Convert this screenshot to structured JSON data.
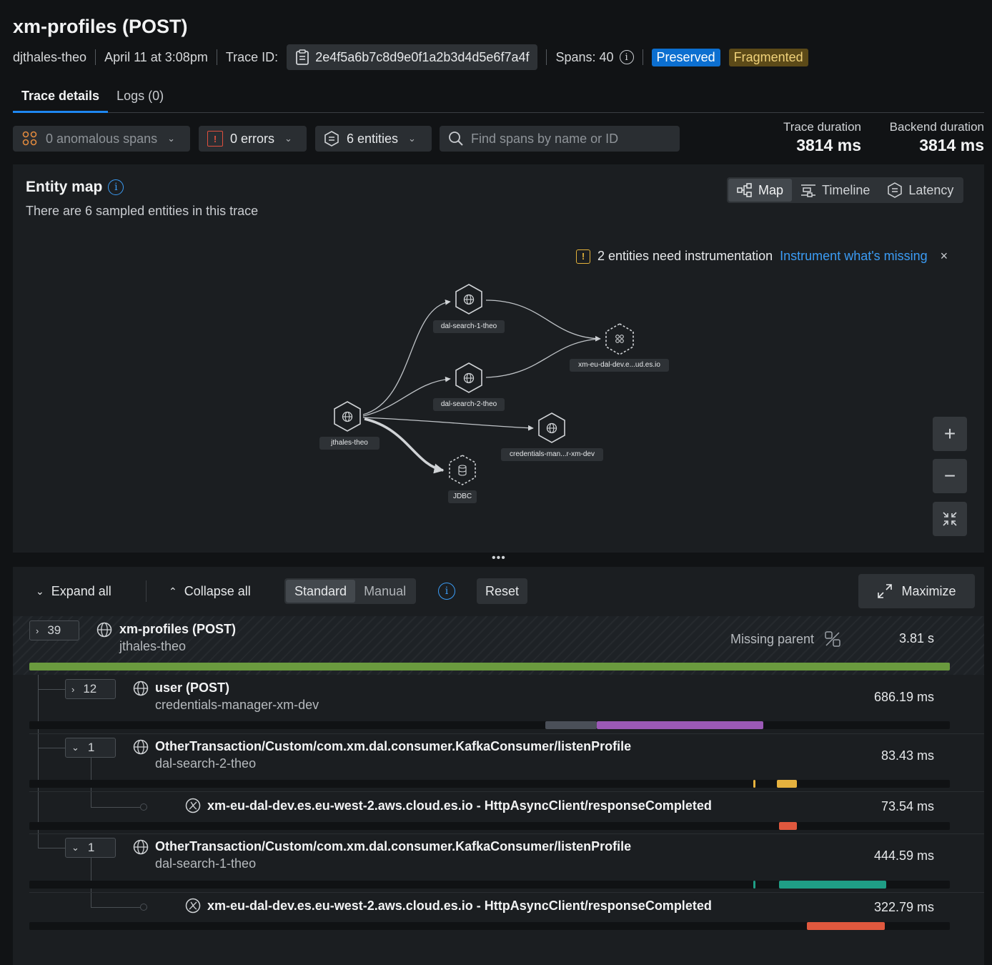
{
  "header": {
    "title": "xm-profiles (POST)",
    "user": "djthales-theo",
    "timestamp": "April 11 at 3:08pm",
    "trace_id_label": "Trace ID:",
    "trace_id": "2e4f5a6b7c8d9e0f1a2b3d4d5e6f7a4f",
    "spans_label": "Spans: 40",
    "badge_preserved": "Preserved",
    "badge_fragmented": "Fragmented"
  },
  "tabs": [
    {
      "label": "Trace details",
      "active": true
    },
    {
      "label": "Logs (0)",
      "active": false
    }
  ],
  "filters": {
    "anomalous": "0 anomalous spans",
    "errors": "0 errors",
    "entities": "6 entities",
    "search_placeholder": "Find spans by name or ID"
  },
  "durations": {
    "trace_label": "Trace duration",
    "trace_value": "3814 ms",
    "backend_label": "Backend duration",
    "backend_value": "3814 ms"
  },
  "entity_map": {
    "title": "Entity map",
    "subtitle": "There are 6 sampled entities in this trace",
    "view_map": "Map",
    "view_timeline": "Timeline",
    "view_latency": "Latency",
    "warning_text": "2 entities need instrumentation",
    "warning_link": "Instrument what's missing",
    "close": "×",
    "nodes": {
      "root": "jthales-theo",
      "search1": "dal-search-1-theo",
      "search2": "dal-search-2-theo",
      "es": "xm-eu-dal-dev.e...ud.es.io",
      "cred": "credentials-man...r-xm-dev",
      "jdbc": "JDBC"
    },
    "zoom_in": "+",
    "zoom_out": "−"
  },
  "toolbar": {
    "expand_all": "Expand all",
    "collapse_all": "Collapse all",
    "mode_standard": "Standard",
    "mode_manual": "Manual",
    "reset": "Reset",
    "maximize": "Maximize"
  },
  "spans": {
    "root": {
      "count": "39",
      "name": "xm-profiles (POST)",
      "entity": "jthales-theo",
      "status": "Missing parent",
      "duration": "3.81 s"
    },
    "s1": {
      "count": "12",
      "name": "user (POST)",
      "entity": "credentials-manager-xm-dev",
      "duration": "686.19 ms"
    },
    "s2": {
      "count": "1",
      "name": "OtherTransaction/Custom/com.xm.dal.consumer.KafkaConsumer/listenProfile",
      "entity": "dal-search-2-theo",
      "duration": "83.43 ms"
    },
    "s3": {
      "name": "xm-eu-dal-dev.es.eu-west-2.aws.cloud.es.io - HttpAsyncClient/responseCompleted",
      "duration": "73.54 ms"
    },
    "s4": {
      "count": "1",
      "name": "OtherTransaction/Custom/com.xm.dal.consumer.KafkaConsumer/listenProfile",
      "entity": "dal-search-1-theo",
      "duration": "444.59 ms"
    },
    "s5": {
      "name": "xm-eu-dal-dev.es.eu-west-2.aws.cloud.es.io - HttpAsyncClient/responseCompleted",
      "duration": "322.79 ms"
    }
  },
  "colors": {
    "accent": "#1e87f0",
    "root_bar": "#6a9a3e",
    "purple": "#9b59b6",
    "yellow": "#e6b23e",
    "red": "#e0583e",
    "teal": "#1f9e86"
  }
}
